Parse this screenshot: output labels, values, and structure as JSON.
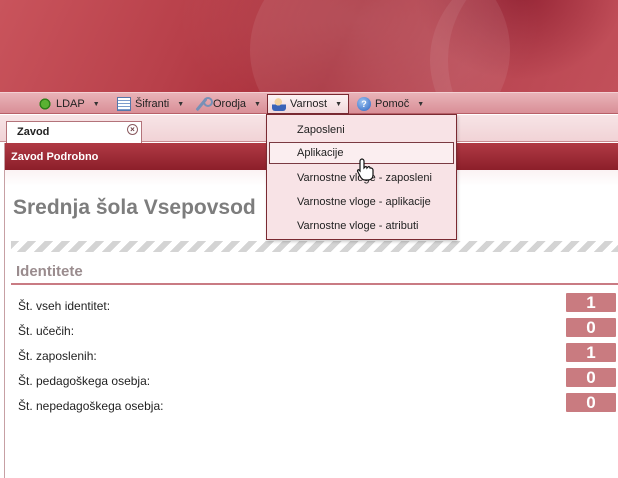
{
  "menubar": {
    "items": [
      {
        "label": "LDAP",
        "icon": "puzzle-icon"
      },
      {
        "label": "Šifranti",
        "icon": "table-icon"
      },
      {
        "label": "Orodja",
        "icon": "wrench-icon"
      },
      {
        "label": "Varnost",
        "icon": "users-icon"
      },
      {
        "label": "Pomoč",
        "icon": "help-icon"
      }
    ]
  },
  "tab": {
    "label": "Zavod",
    "close_symbol": "×"
  },
  "panel": {
    "header": "Zavod Podrobno"
  },
  "school": {
    "title": "Srednja šola Vsepovsod"
  },
  "identitete": {
    "title": "Identitete",
    "rows": [
      {
        "label": "Št. vseh identitet:",
        "value": "1"
      },
      {
        "label": "Št. učečih:",
        "value": "0"
      },
      {
        "label": "Št. zaposlenih:",
        "value": "1"
      },
      {
        "label": "Št. pedagoškega osebja:",
        "value": "0"
      },
      {
        "label": "Št. nepedagoškega osebja:",
        "value": "0"
      }
    ]
  },
  "dropdown": {
    "items": [
      {
        "label": "Zaposleni"
      },
      {
        "label": "Aplikacije"
      },
      {
        "label": "Varnostne vloge - zaposleni"
      },
      {
        "label": "Varnostne vloge - aplikacije"
      },
      {
        "label": "Varnostne vloge - atributi"
      }
    ]
  },
  "colors": {
    "accent": "#8c1f2a",
    "badge": "#c97b80",
    "menubar": "#e0a2a9"
  }
}
